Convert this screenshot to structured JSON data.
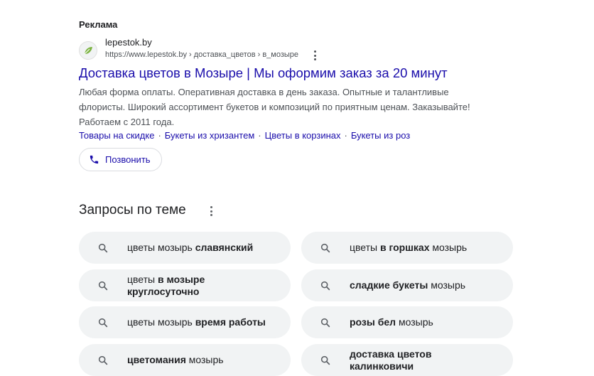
{
  "ad": {
    "label": "Реклама",
    "site_name": "lepestok.by",
    "url": "https://www.lepestok.by › доставка_цветов › в_мозыре",
    "title": "Доставка цветов в Мозыре | Мы оформим заказ за 20 минут",
    "description_lines": [
      "Любая форма оплаты. Оперативная доставка в день заказа. Опытные и талантливые",
      "флористы. Широкий ассортимент букетов и композиций по приятным ценам. Заказывайте!",
      "Работаем с 2011 года."
    ],
    "sitelinks": [
      "Товары на скидке",
      "Букеты из хризантем",
      "Цветы в корзинах",
      "Букеты из роз"
    ],
    "sitelink_separator": "·",
    "call_button": "Позвонить"
  },
  "related": {
    "heading": "Запросы по теме",
    "items": [
      {
        "normal": "цветы мозырь ",
        "bold": "славянский",
        "after": ""
      },
      {
        "normal": "цветы ",
        "bold": "в горшках",
        "after": " мозырь"
      },
      {
        "normal": "цветы ",
        "bold": "в мозыре круглосуточно",
        "after": ""
      },
      {
        "normal": "",
        "bold": "сладкие букеты",
        "after": " мозырь"
      },
      {
        "normal": "цветы мозырь ",
        "bold": "время работы",
        "after": ""
      },
      {
        "normal": "",
        "bold": "розы бел",
        "after": " мозырь"
      },
      {
        "normal": "",
        "bold": "цветомания",
        "after": " мозырь"
      },
      {
        "normal": "",
        "bold": "доставка цветов калинковичи",
        "after": ""
      }
    ]
  },
  "colors": {
    "link": "#1a0dab",
    "chip_bg": "#f1f3f4",
    "text": "#202124",
    "muted": "#4d5156",
    "favicon_leaf": "#7cb342"
  },
  "icons": {
    "favicon": "leaf-icon",
    "call": "phone-icon",
    "chip": "search-icon",
    "menu": "more-vert-icon"
  }
}
